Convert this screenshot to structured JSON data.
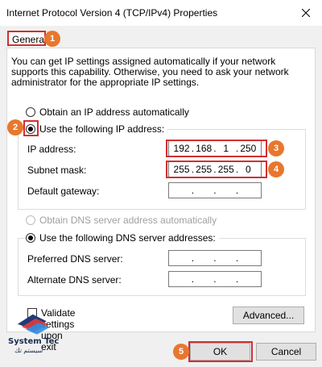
{
  "window": {
    "title": "Internet Protocol Version 4 (TCP/IPv4) Properties",
    "close_icon": "close-icon"
  },
  "tabs": [
    {
      "label": "General",
      "active": true
    }
  ],
  "intro_text": "You can get IP settings assigned automatically if your network supports this capability. Otherwise, you need to ask your network administrator for the appropriate IP settings.",
  "ip_mode": {
    "auto_label": "Obtain an IP address automatically",
    "manual_label": "Use the following IP address:",
    "selected": "manual"
  },
  "ip_fields": [
    {
      "label": "IP address:",
      "octets": [
        "192",
        "168",
        "1",
        "250"
      ]
    },
    {
      "label": "Subnet mask:",
      "octets": [
        "255",
        "255",
        "255",
        "0"
      ]
    },
    {
      "label": "Default gateway:",
      "octets": [
        "",
        "",
        "",
        ""
      ]
    }
  ],
  "dns_mode": {
    "auto_label": "Obtain DNS server address automatically",
    "manual_label": "Use the following DNS server addresses:",
    "selected": "manual"
  },
  "dns_fields": [
    {
      "label": "Preferred DNS server:",
      "octets": [
        "",
        "",
        "",
        ""
      ]
    },
    {
      "label": "Alternate DNS server:",
      "octets": [
        "",
        "",
        "",
        ""
      ]
    }
  ],
  "validate": {
    "label": "Validate settings upon exit",
    "checked": false
  },
  "buttons": {
    "advanced": "Advanced...",
    "ok": "OK",
    "cancel": "Cancel"
  },
  "annotations": [
    "1",
    "2",
    "3",
    "4",
    "5"
  ],
  "watermark": {
    "brand": "System Tec",
    "subtitle": "سيستم تك"
  },
  "colors": {
    "marker": "#e8772e",
    "highlight": "#d32f2f",
    "accent": "#0078d7"
  }
}
